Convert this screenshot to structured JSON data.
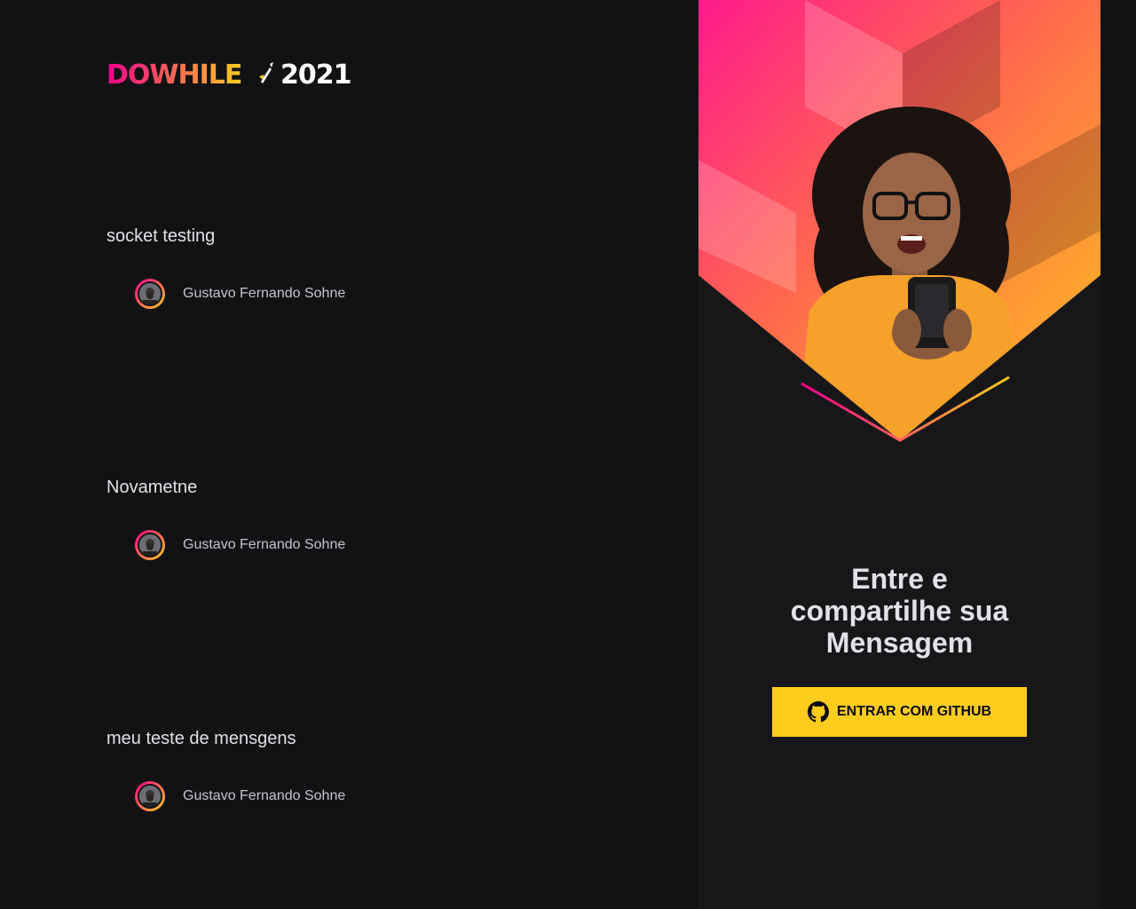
{
  "logo": {
    "alt": "DoWhile 2021",
    "brand_text": "DOWHILE",
    "year_text": "2021"
  },
  "messages": [
    {
      "content": "socket testing",
      "user_name": "Gustavo Fernando Sohne"
    },
    {
      "content": "Novametne",
      "user_name": "Gustavo Fernando Sohne"
    },
    {
      "content": "meu teste de mensgens",
      "user_name": "Gustavo Fernando Sohne"
    }
  ],
  "login": {
    "title_lines": [
      "Entre e",
      "compartilhe sua",
      "Mensagem"
    ],
    "button_label": "ENTRAR COM GITHUB",
    "button_icon": "github-icon"
  },
  "colors": {
    "background": "#121214",
    "panel": "#17171a",
    "text": "#e1e1e6",
    "accent_pink": "#ff008e",
    "accent_yellow": "#ffcd1e"
  }
}
